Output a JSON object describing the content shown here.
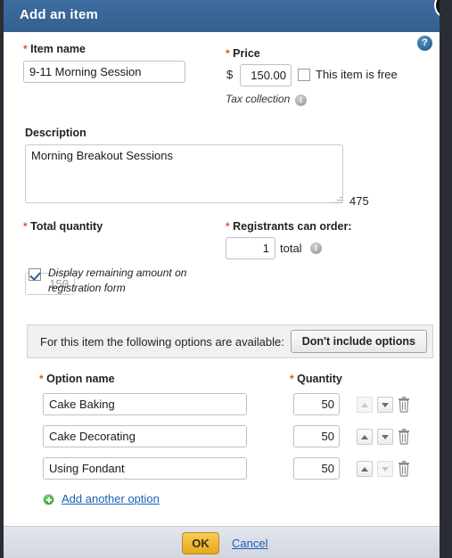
{
  "dialog": {
    "title": "Add an item",
    "close_icon": "close-icon",
    "help_icon": "?"
  },
  "form": {
    "item_name": {
      "label": "Item name",
      "required_marker": "*",
      "value": "9-11 Morning Session"
    },
    "price": {
      "label": "Price",
      "required_marker": "*",
      "currency_symbol": "$",
      "value": "150.00",
      "free_checkbox_label": "This item is free",
      "free_checked": false,
      "tax_collection_label": "Tax collection",
      "tax_info_icon": "i"
    },
    "description": {
      "label": "Description",
      "value": "Morning Breakout Sessions",
      "chars_remaining": "475"
    },
    "total_quantity": {
      "label": "Total quantity",
      "required_marker": "*",
      "value": "150",
      "display_remaining_label": "Display remaining amount on registration form",
      "display_remaining_checked": true
    },
    "registrants_can_order": {
      "label": "Registrants can order:",
      "required_marker": "*",
      "value": "1",
      "unit_label": "total",
      "info_icon": "i"
    }
  },
  "options_section": {
    "panel_text": "For this item the following options are available:",
    "toggle_button_label": "Don't include options",
    "columns": {
      "name_header": "Option name",
      "quantity_header": "Quantity",
      "required_marker": "*"
    },
    "rows": [
      {
        "name": "Cake Baking",
        "quantity": "50",
        "up_enabled": false,
        "down_enabled": true
      },
      {
        "name": "Cake Decorating",
        "quantity": "50",
        "up_enabled": true,
        "down_enabled": true
      },
      {
        "name": "Using Fondant",
        "quantity": "50",
        "up_enabled": true,
        "down_enabled": false
      }
    ],
    "add_another_label": "Add another option",
    "add_icon": "plus-circle-icon",
    "delete_icon": "trash-icon"
  },
  "footer": {
    "ok_label": "OK",
    "cancel_label": "Cancel"
  },
  "colors": {
    "titlebar": "#39679b",
    "required_star": "#e8502b",
    "link": "#1a5fb4",
    "ok_button": "#e7a81e",
    "add_icon_green": "#3fbb3f",
    "page_background": "#2b2d35"
  }
}
